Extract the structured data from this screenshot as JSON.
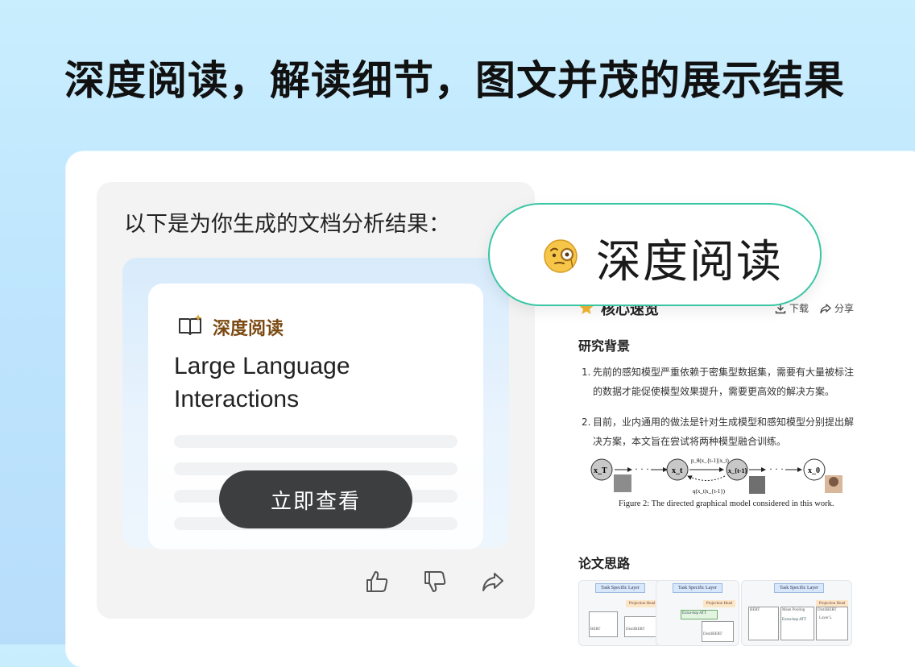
{
  "hero": {
    "title": "深度阅读，解读细节，图文并茂的展示结果"
  },
  "chat": {
    "intro": "以下是为你生成的文档分析结果：",
    "doc_card": {
      "badge_icon": "book-sparkle-icon",
      "badge_label": "深度阅读",
      "title": "Large Language Interactions",
      "view_button": "立即查看"
    },
    "actions": [
      {
        "icon": "thumbs-up-icon"
      },
      {
        "icon": "thumbs-down-icon"
      },
      {
        "icon": "share-icon"
      }
    ]
  },
  "feature_pill": {
    "emoji": "face-with-monocle",
    "label": "深度阅读"
  },
  "preview": {
    "header": {
      "icon": "star-icon",
      "title": "核心速览",
      "download_label": "下载",
      "share_label": "分享"
    },
    "background": {
      "title": "研究背景",
      "items": [
        {
          "num": "1.",
          "text": "先前的感知模型严重依赖于密集型数据集，需要有大量被标注的数据才能促使模型效果提升，需要更高效的解决方案。"
        },
        {
          "num": "2.",
          "text": "目前，业内通用的做法是针对生成模型和感知模型分别提出解决方案，本文旨在尝试将两种模型融合训练。"
        }
      ]
    },
    "figure": {
      "nodes": [
        "x_T",
        "x_t",
        "x_{t-1}",
        "x_0"
      ],
      "forward_label": "p_θ(x_{t-1}|x_t)",
      "backward_label": "q(x_t|x_{t-1})",
      "caption": "Figure 2: The directed graphical model considered in this work."
    },
    "approach": {
      "title": "论文思路",
      "thumbnails": [
        {
          "top_label": "Task Specific Layer",
          "head_label": "Projection Head",
          "labels": [
            "BERT",
            "DistilBERT"
          ]
        },
        {
          "top_label": "Task Specific Layer",
          "head_label": "Projection Head",
          "labels": [
            "Extra-hop ATT",
            "DistilBERT"
          ]
        },
        {
          "top_label": "Task Specific Layer",
          "head_label": "Projection Head",
          "labels": [
            "BERT",
            "Mean Pooling",
            "DistilBERT",
            "Layer L",
            "Extra-hop ATT"
          ]
        }
      ]
    }
  }
}
